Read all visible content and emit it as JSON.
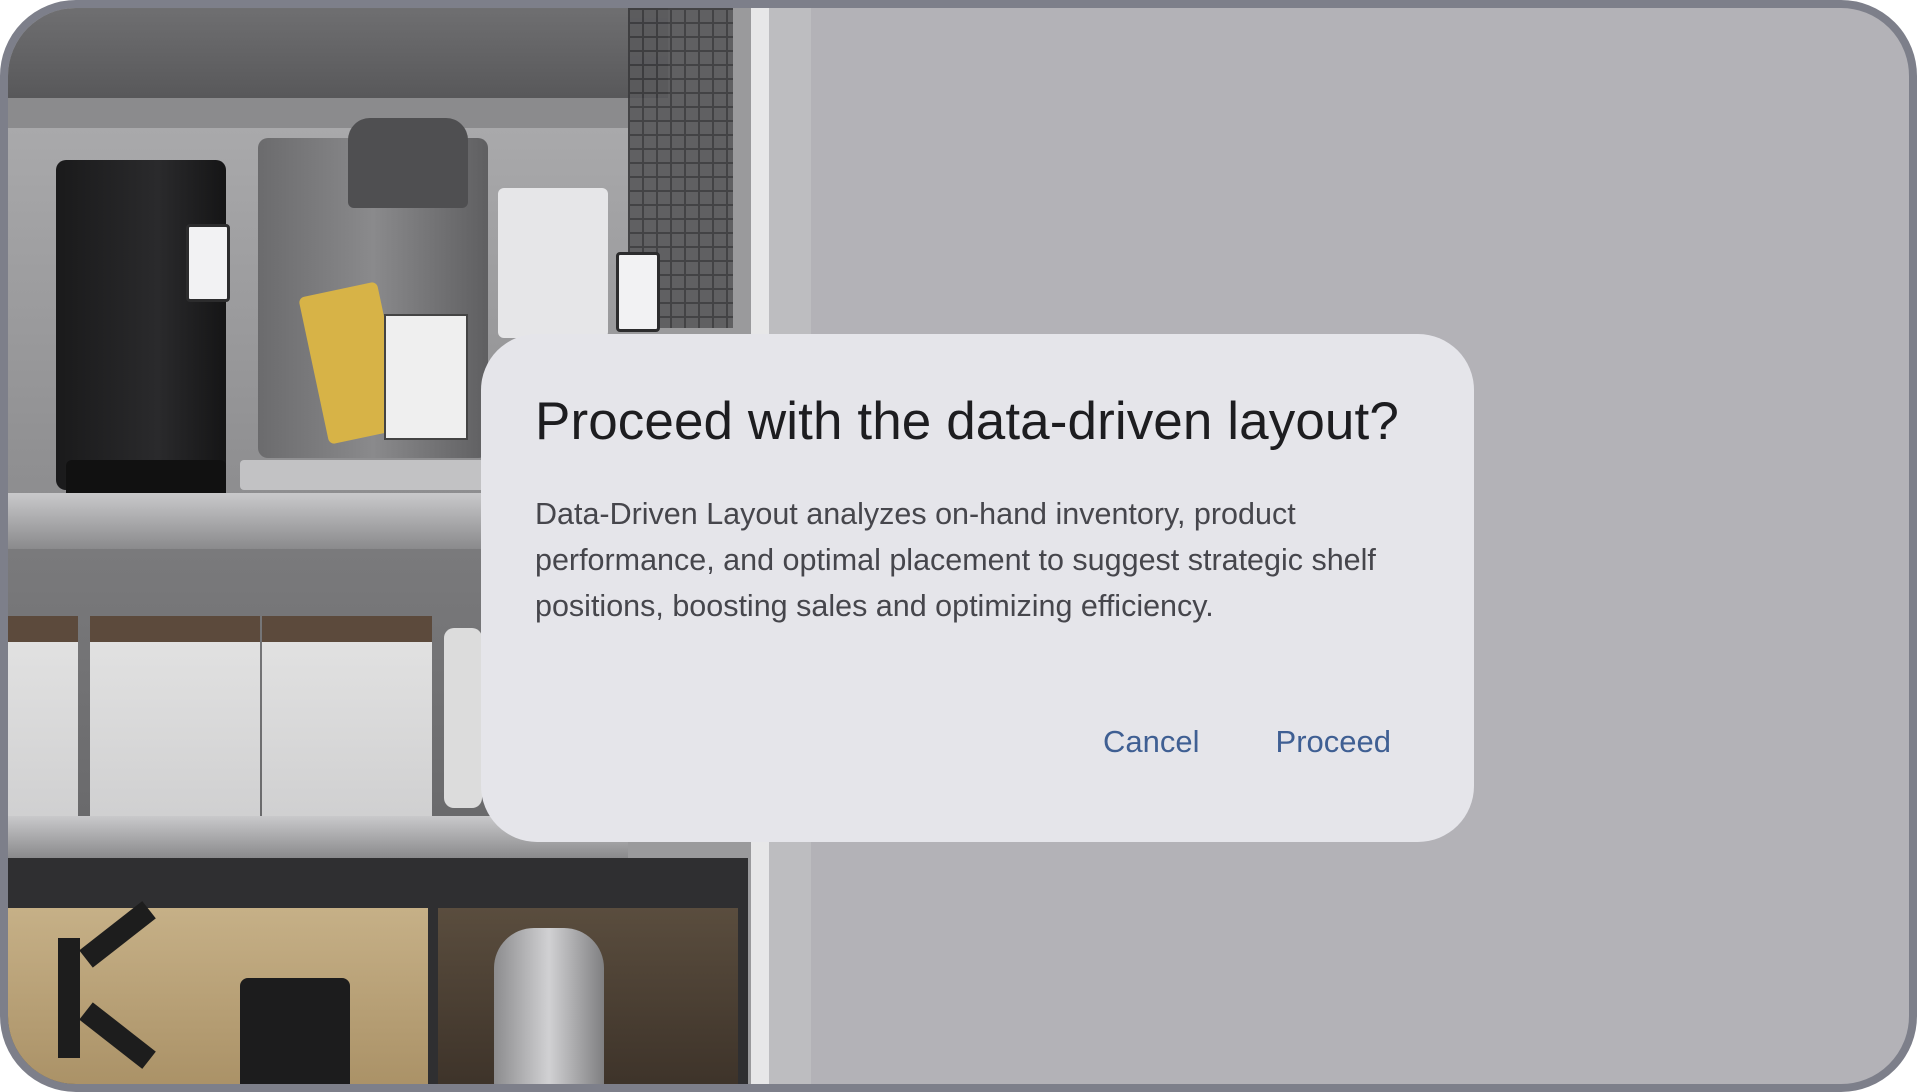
{
  "dialog": {
    "title": "Proceed with the data-driven layout?",
    "body": "Data-Driven Layout analyzes on-hand inventory, product performance, and optimal placement to suggest strategic shelf positions, boosting sales and optimizing efficiency.",
    "cancel_label": "Cancel",
    "proceed_label": "Proceed"
  },
  "colors": {
    "scrim": "#b3b2b7",
    "dialog_surface": "#e5e5ea",
    "title_text": "#1d1d20",
    "body_text": "#46464c",
    "action_text": "#3f5f93",
    "frame_border": "#7d7f8a"
  }
}
